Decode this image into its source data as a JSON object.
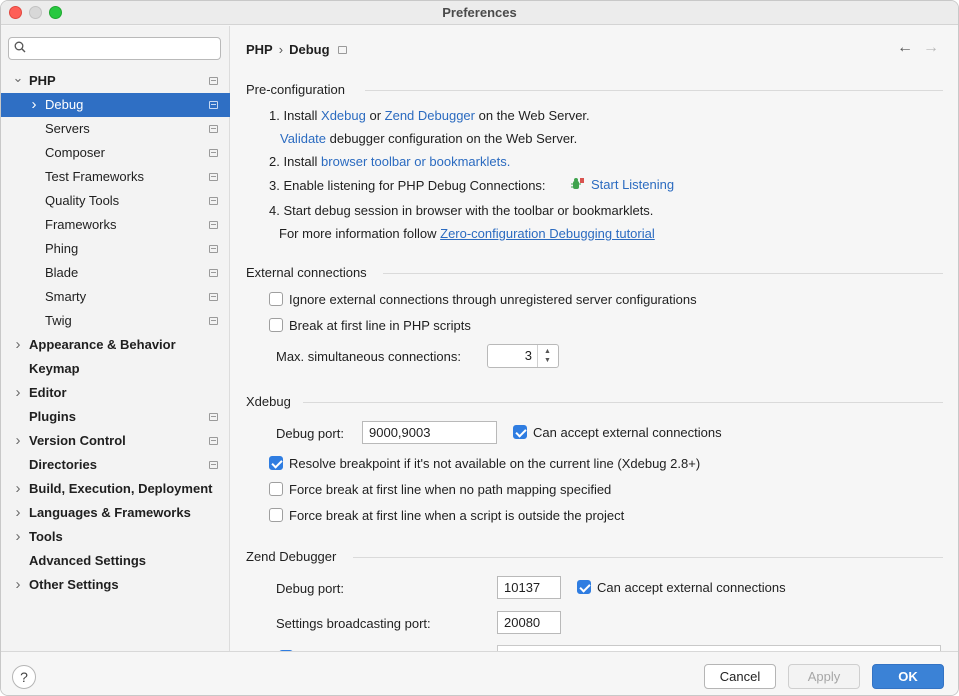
{
  "window": {
    "title": "Preferences"
  },
  "search": {
    "placeholder": ""
  },
  "sidebar": {
    "items": [
      {
        "label": "PHP",
        "bold": true,
        "expanded": true,
        "project": true
      },
      {
        "label": "Debug",
        "selected": true,
        "collapsed": true,
        "project": true
      },
      {
        "label": "Servers",
        "project": true
      },
      {
        "label": "Composer",
        "project": true
      },
      {
        "label": "Test Frameworks",
        "project": true
      },
      {
        "label": "Quality Tools",
        "project": true
      },
      {
        "label": "Frameworks",
        "project": true
      },
      {
        "label": "Phing",
        "project": true
      },
      {
        "label": "Blade",
        "project": true
      },
      {
        "label": "Smarty",
        "project": true
      },
      {
        "label": "Twig",
        "project": true
      },
      {
        "label": "Appearance & Behavior",
        "bold": true
      },
      {
        "label": "Keymap",
        "bold": true
      },
      {
        "label": "Editor",
        "bold": true
      },
      {
        "label": "Plugins",
        "bold": true,
        "project": true
      },
      {
        "label": "Version Control",
        "bold": true,
        "project": true
      },
      {
        "label": "Directories",
        "bold": true,
        "project": true
      },
      {
        "label": "Build, Execution, Deployment",
        "bold": true
      },
      {
        "label": "Languages & Frameworks",
        "bold": true
      },
      {
        "label": "Tools",
        "bold": true
      },
      {
        "label": "Advanced Settings",
        "bold": true
      },
      {
        "label": "Other Settings",
        "bold": true
      }
    ]
  },
  "breadcrumb": {
    "parent": "PHP",
    "sep": "›",
    "current": "Debug"
  },
  "nav": {
    "back": "←",
    "forward": "→"
  },
  "preconfig": {
    "title": "Pre-configuration",
    "step1_prefix": "1. Install ",
    "step1_xdebug": "Xdebug",
    "step1_or": " or ",
    "step1_zend": "Zend Debugger",
    "step1_suffix": " on the Web Server.",
    "validate_link": "Validate",
    "validate_suffix": " debugger configuration on the Web Server.",
    "step2_prefix": "2. Install ",
    "step2_link": "browser toolbar or bookmarklets.",
    "step3_prefix": "3. Enable listening for PHP Debug Connections:",
    "step3_link": "Start Listening",
    "step4": "4. Start debug session in browser with the toolbar or bookmarklets.",
    "info_prefix": "For more information follow ",
    "info_link": "Zero-configuration Debugging tutorial"
  },
  "external": {
    "title": "External connections",
    "ignore_label": "Ignore external connections through unregistered server configurations",
    "ignore_checked": false,
    "break_label": "Break at first line in PHP scripts",
    "break_checked": false,
    "max_label": "Max. simultaneous connections:",
    "max_value": "3",
    "spin_up": "▲",
    "spin_down": "▼"
  },
  "xdebug": {
    "title": "Xdebug",
    "port_label": "Debug port:",
    "port_value": "9000,9003",
    "accept_label": "Can accept external connections",
    "accept_checked": true,
    "resolve_label": "Resolve breakpoint if it's not available on the current line (Xdebug 2.8+)",
    "resolve_checked": true,
    "force_path_label": "Force break at first line when no path mapping specified",
    "force_path_checked": false,
    "force_outside_label": "Force break at first line when a script is outside the project",
    "force_outside_checked": false
  },
  "zend": {
    "title": "Zend Debugger",
    "port_label": "Debug port:",
    "port_value": "10137",
    "accept_label": "Can accept external connections",
    "accept_checked": true,
    "broadcast_label": "Settings broadcasting port:",
    "broadcast_value": "20080"
  },
  "buttons": {
    "help": "?",
    "cancel": "Cancel",
    "apply": "Apply",
    "ok": "OK"
  },
  "colors": {
    "accent": "#2f6fc4",
    "link": "#2b6bc0",
    "ok": "#3b82d6"
  },
  "icons": {
    "search": "search-icon",
    "listen": "debug-listen-icon",
    "project": "project-scope-icon"
  }
}
